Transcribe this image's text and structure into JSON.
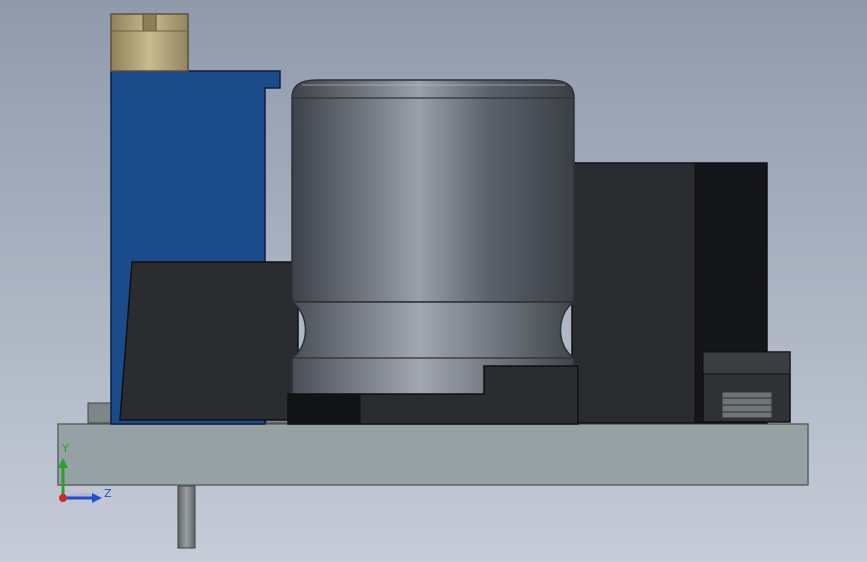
{
  "viewport": {
    "background_top": "#8f9aab",
    "background_bottom": "#c6ccd8"
  },
  "colors": {
    "pcb": "#96a1a4",
    "pcb_edge": "#5c6466",
    "blue_part": "#1c4b8c",
    "brass_screw": "#b7a77a",
    "dark_block": "#2b2c2f",
    "black_part": "#121315",
    "capacitor_light": "#8b909a",
    "capacitor_mid": "#5b616b",
    "capacitor_dark": "#3d424a",
    "pin": "#7a8080",
    "smd_tan": "#c8a458",
    "axis_green": "#2ca02c",
    "axis_blue": "#1f4fd6",
    "axis_red": "#d62728"
  },
  "axes": {
    "y_label": "Y",
    "z_label": "Z"
  }
}
